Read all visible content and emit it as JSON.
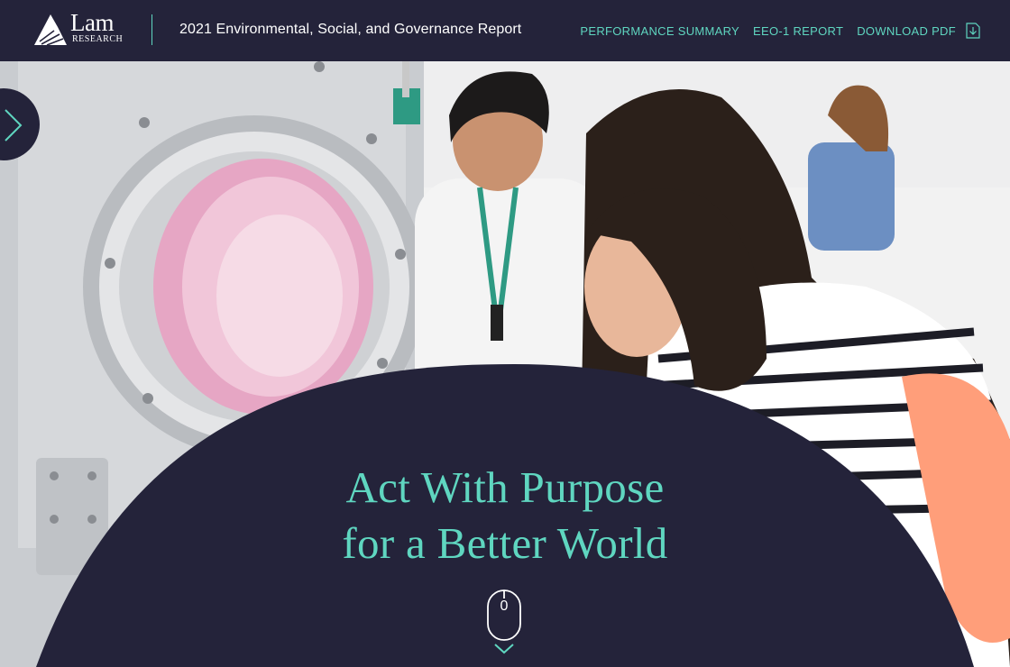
{
  "header": {
    "logo_text": "Lam",
    "logo_subtext": "RESEARCH",
    "report_title": "2021 Environmental, Social, and Governance Report",
    "nav": [
      {
        "label": "PERFORMANCE SUMMARY"
      },
      {
        "label": "EEO-1 REPORT"
      },
      {
        "label": "DOWNLOAD PDF",
        "icon": "download-icon"
      }
    ]
  },
  "side_tab": {
    "icon": "chevron-right-icon"
  },
  "hero": {
    "headline_line1": "Act With Purpose",
    "headline_line2": "for a Better World",
    "scroll_indicator": {
      "icon": "mouse-icon",
      "value": "0"
    },
    "scroll_down_icon": "chevron-down-icon"
  },
  "colors": {
    "navy": "#24233a",
    "accent_teal": "#5fd6c0",
    "white": "#ffffff"
  }
}
